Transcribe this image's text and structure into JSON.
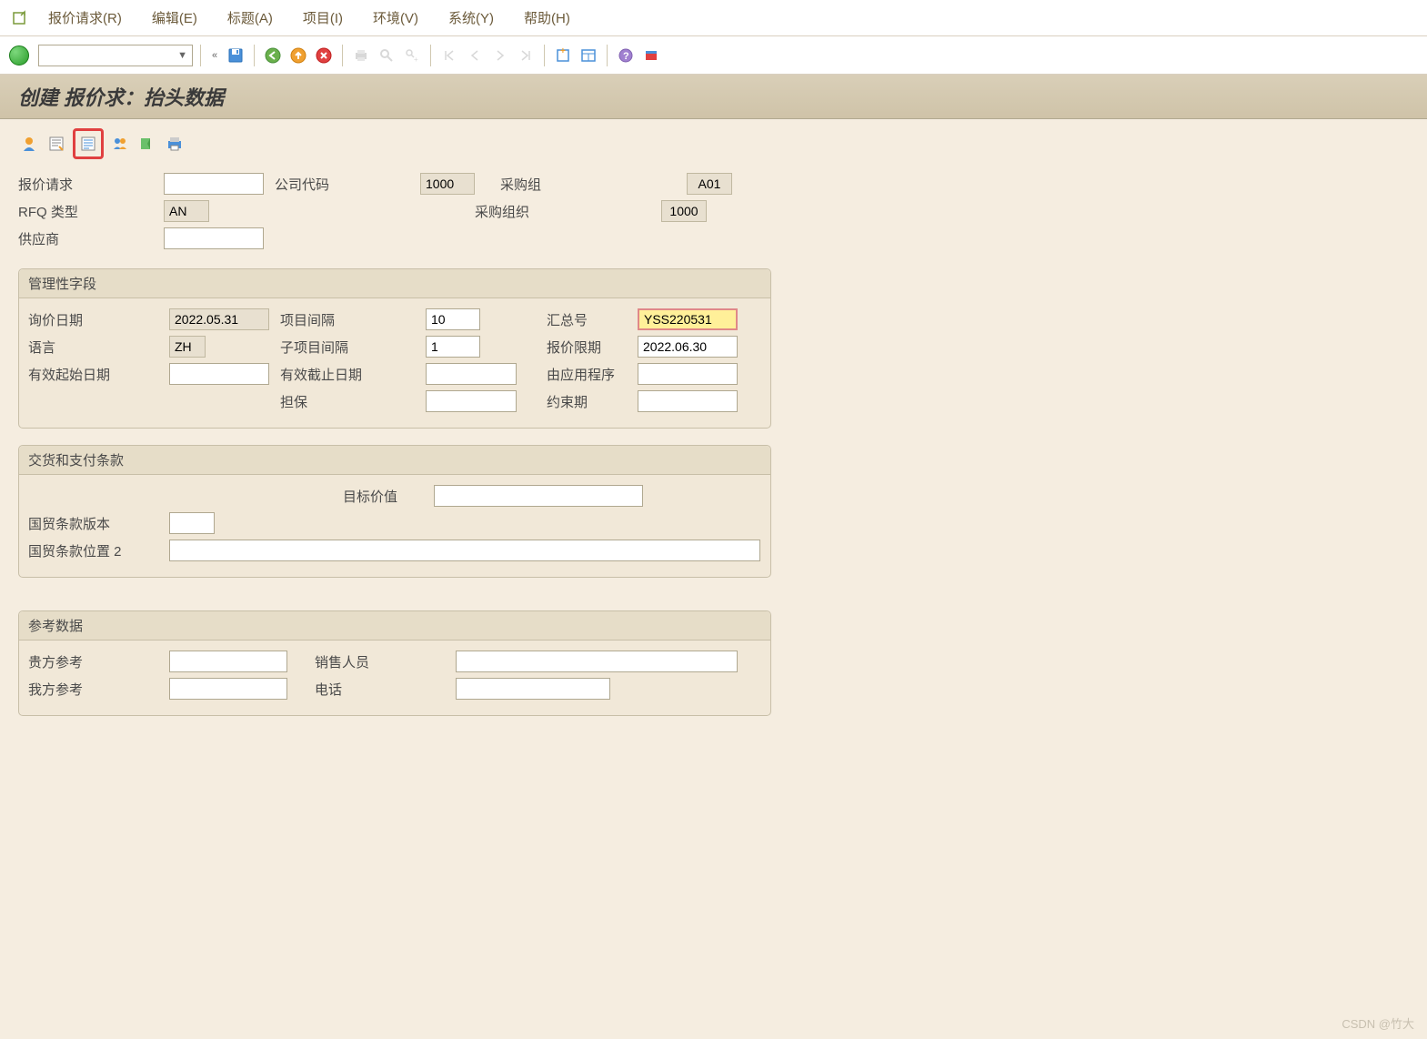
{
  "menu": {
    "rfq": "报价请求(R)",
    "edit": "编辑(E)",
    "header": "标题(A)",
    "item": "项目(I)",
    "environment": "环境(V)",
    "system": "系统(Y)",
    "help": "帮助(H)"
  },
  "title": "创建 报价求：抬头数据",
  "header": {
    "rfq_label": "报价请求",
    "rfq_value": "",
    "company_code_label": "公司代码",
    "company_code_value": "1000",
    "purch_group_label": "采购组",
    "purch_group_value": "A01",
    "rfq_type_label": "RFQ 类型",
    "rfq_type_value": "AN",
    "purch_org_label": "采购组织",
    "purch_org_value": "1000",
    "vendor_label": "供应商",
    "vendor_value": ""
  },
  "admin": {
    "title": "管理性字段",
    "rfq_date_label": "询价日期",
    "rfq_date_value": "2022.05.31",
    "item_interval_label": "项目间隔",
    "item_interval_value": "10",
    "coll_no_label": "汇总号",
    "coll_no_value": "YSS220531",
    "language_label": "语言",
    "language_value": "ZH",
    "subitem_interval_label": "子项目间隔",
    "subitem_interval_value": "1",
    "quot_deadline_label": "报价限期",
    "quot_deadline_value": "2022.06.30",
    "valid_start_label": "有效起始日期",
    "valid_start_value": "",
    "valid_end_label": "有效截止日期",
    "valid_end_value": "",
    "appl_by_label": "由应用程序",
    "appl_by_value": "",
    "warranty_label": "担保",
    "warranty_value": "",
    "binding_label": "约束期",
    "binding_value": ""
  },
  "terms": {
    "title": "交货和支付条款",
    "target_value_label": "目标价值",
    "target_value_value": "",
    "incoterms_ver_label": "国贸条款版本",
    "incoterms_ver_value": "",
    "incoterms_loc_label": "国贸条款位置 2",
    "incoterms_loc_value": ""
  },
  "reference": {
    "title": "参考数据",
    "your_ref_label": "贵方参考",
    "your_ref_value": "",
    "salesperson_label": "销售人员",
    "salesperson_value": "",
    "our_ref_label": "我方参考",
    "our_ref_value": "",
    "telephone_label": "电话",
    "telephone_value": ""
  },
  "watermark": "CSDN @竹大"
}
